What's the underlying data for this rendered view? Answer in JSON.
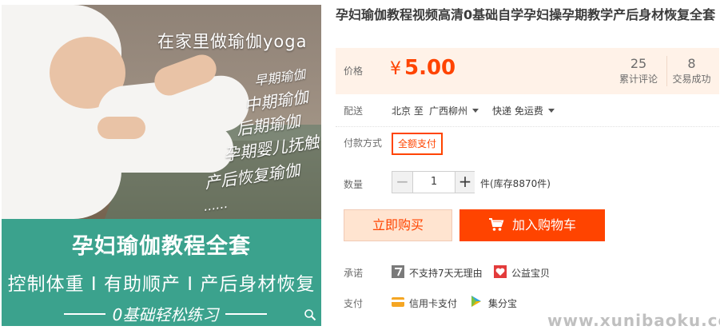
{
  "product": {
    "title": "孕妇瑜伽教程视频高清0基础自学孕妇操孕期教学产后身材恢复全套",
    "image": {
      "caption_top": "在家里做瑜伽yoga",
      "captions": [
        "早期瑜伽",
        "中期瑜伽",
        "后期瑜伽",
        "孕期婴儿抚触",
        "产后恢复瑜伽",
        "......"
      ],
      "banner_title": "孕妇瑜伽教程全套",
      "banner_sub": "控制体重 I 有助顺产 I 产后身材恢复",
      "banner_foot": "0基础轻松练习",
      "banner_color": "#3ba28d"
    }
  },
  "price": {
    "label": "价格",
    "currency": "¥",
    "value": "5.00",
    "color": "#ff4400",
    "stats": [
      {
        "value": "25",
        "label": "累计评论"
      },
      {
        "value": "8",
        "label": "交易成功"
      }
    ]
  },
  "shipping": {
    "label": "配送",
    "from": "北京 至",
    "to": "广西柳州",
    "method": "快递 免运费"
  },
  "payment_method": {
    "label": "付款方式",
    "option": "全额支付"
  },
  "quantity": {
    "label": "数量",
    "minus": "−",
    "value": "1",
    "plus": "+",
    "stock": "件(库存8870件)"
  },
  "buttons": {
    "buy_now": "立即购买",
    "add_to_cart": "加入购物车"
  },
  "promise": {
    "label": "承诺",
    "items": [
      {
        "icon": "seven-day-icon",
        "text": "不支持7天无理由"
      },
      {
        "icon": "charity-heart-icon",
        "text": "公益宝贝"
      }
    ]
  },
  "pay": {
    "label": "支付",
    "items": [
      {
        "icon": "credit-card-icon",
        "text": "信用卡支付"
      },
      {
        "icon": "points-icon",
        "text": "集分宝"
      }
    ]
  },
  "watermark": "www.xunibaoku.com"
}
